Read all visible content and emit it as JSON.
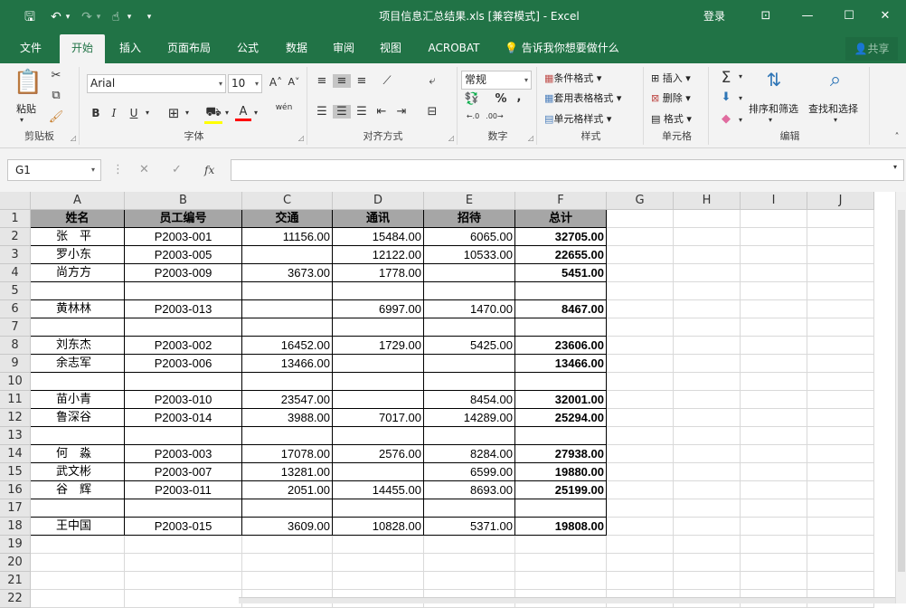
{
  "window": {
    "title": "项目信息汇总结果.xls  [兼容模式]  -  Excel",
    "login": "登录",
    "controls": [
      "⊡",
      "—",
      "☐",
      "✕"
    ]
  },
  "quick_access": {
    "save": "🖫",
    "undo": "↶",
    "undo_drop": "▾",
    "redo": "↷",
    "redo_drop": "▾",
    "touch": "☝",
    "touch_drop": "▾",
    "customize": "▾"
  },
  "tabs": [
    "文件",
    "开始",
    "插入",
    "页面布局",
    "公式",
    "数据",
    "审阅",
    "视图",
    "ACROBAT"
  ],
  "active_tab": "开始",
  "tell_me": "告诉我你想要做什么",
  "share": "共享",
  "ribbon": {
    "clipboard": {
      "label": "剪贴板",
      "paste": "粘贴"
    },
    "font": {
      "label": "字体",
      "name": "Arial",
      "size": "10",
      "grow": "A˄",
      "shrink": "A˅",
      "bold": "B",
      "italic": "I",
      "underline": "U",
      "phonetic": "wén"
    },
    "alignment": {
      "label": "对齐方式"
    },
    "number": {
      "label": "数字",
      "format": "常规",
      "percent": "%",
      "comma": ","
    },
    "styles": {
      "label": "样式",
      "conditional": "条件格式",
      "table": "套用表格格式",
      "cell": "单元格样式"
    },
    "cells": {
      "label": "单元格",
      "insert": "插入",
      "delete": "删除",
      "format": "格式"
    },
    "editing": {
      "label": "编辑",
      "sort": "排序和筛选",
      "find": "查找和选择"
    }
  },
  "formula_bar": {
    "name_box": "G1",
    "cancel": "✕",
    "enter": "✓",
    "fx": "fx",
    "value": ""
  },
  "columns": [
    "A",
    "B",
    "C",
    "D",
    "E",
    "F",
    "G",
    "H",
    "I",
    "J"
  ],
  "rows": [
    "1",
    "2",
    "3",
    "4",
    "5",
    "6",
    "7",
    "8",
    "9",
    "10",
    "11",
    "12",
    "13",
    "14",
    "15",
    "16",
    "17",
    "18",
    "19",
    "20",
    "21",
    "22"
  ],
  "table": {
    "headers": [
      "姓名",
      "员工编号",
      "交通",
      "通讯",
      "招待",
      "总计"
    ],
    "rows": [
      [
        "张　平",
        "P2003-001",
        "11156.00",
        "15484.00",
        "6065.00",
        "32705.00"
      ],
      [
        "罗小东",
        "P2003-005",
        "",
        "12122.00",
        "10533.00",
        "22655.00"
      ],
      [
        "尚方方",
        "P2003-009",
        "3673.00",
        "1778.00",
        "",
        "5451.00"
      ],
      [
        "",
        "",
        "",
        "",
        "",
        ""
      ],
      [
        "黄林林",
        "P2003-013",
        "",
        "6997.00",
        "1470.00",
        "8467.00"
      ],
      [
        "",
        "",
        "",
        "",
        "",
        ""
      ],
      [
        "刘东杰",
        "P2003-002",
        "16452.00",
        "1729.00",
        "5425.00",
        "23606.00"
      ],
      [
        "余志军",
        "P2003-006",
        "13466.00",
        "",
        "",
        "13466.00"
      ],
      [
        "",
        "",
        "",
        "",
        "",
        ""
      ],
      [
        "苗小青",
        "P2003-010",
        "23547.00",
        "",
        "8454.00",
        "32001.00"
      ],
      [
        "鲁深谷",
        "P2003-014",
        "3988.00",
        "7017.00",
        "14289.00",
        "25294.00"
      ],
      [
        "",
        "",
        "",
        "",
        "",
        ""
      ],
      [
        "何　淼",
        "P2003-003",
        "17078.00",
        "2576.00",
        "8284.00",
        "27938.00"
      ],
      [
        "武文彬",
        "P2003-007",
        "13281.00",
        "",
        "6599.00",
        "19880.00"
      ],
      [
        "谷　辉",
        "P2003-011",
        "2051.00",
        "14455.00",
        "8693.00",
        "25199.00"
      ],
      [
        "",
        "",
        "",
        "",
        "",
        ""
      ],
      [
        "王中国",
        "P2003-015",
        "3609.00",
        "10828.00",
        "5371.00",
        "19808.00"
      ]
    ]
  },
  "colors": {
    "excel_green": "#217346",
    "ribbon_bg": "#f3f3f3",
    "header_fill": "#a6a6a6"
  }
}
